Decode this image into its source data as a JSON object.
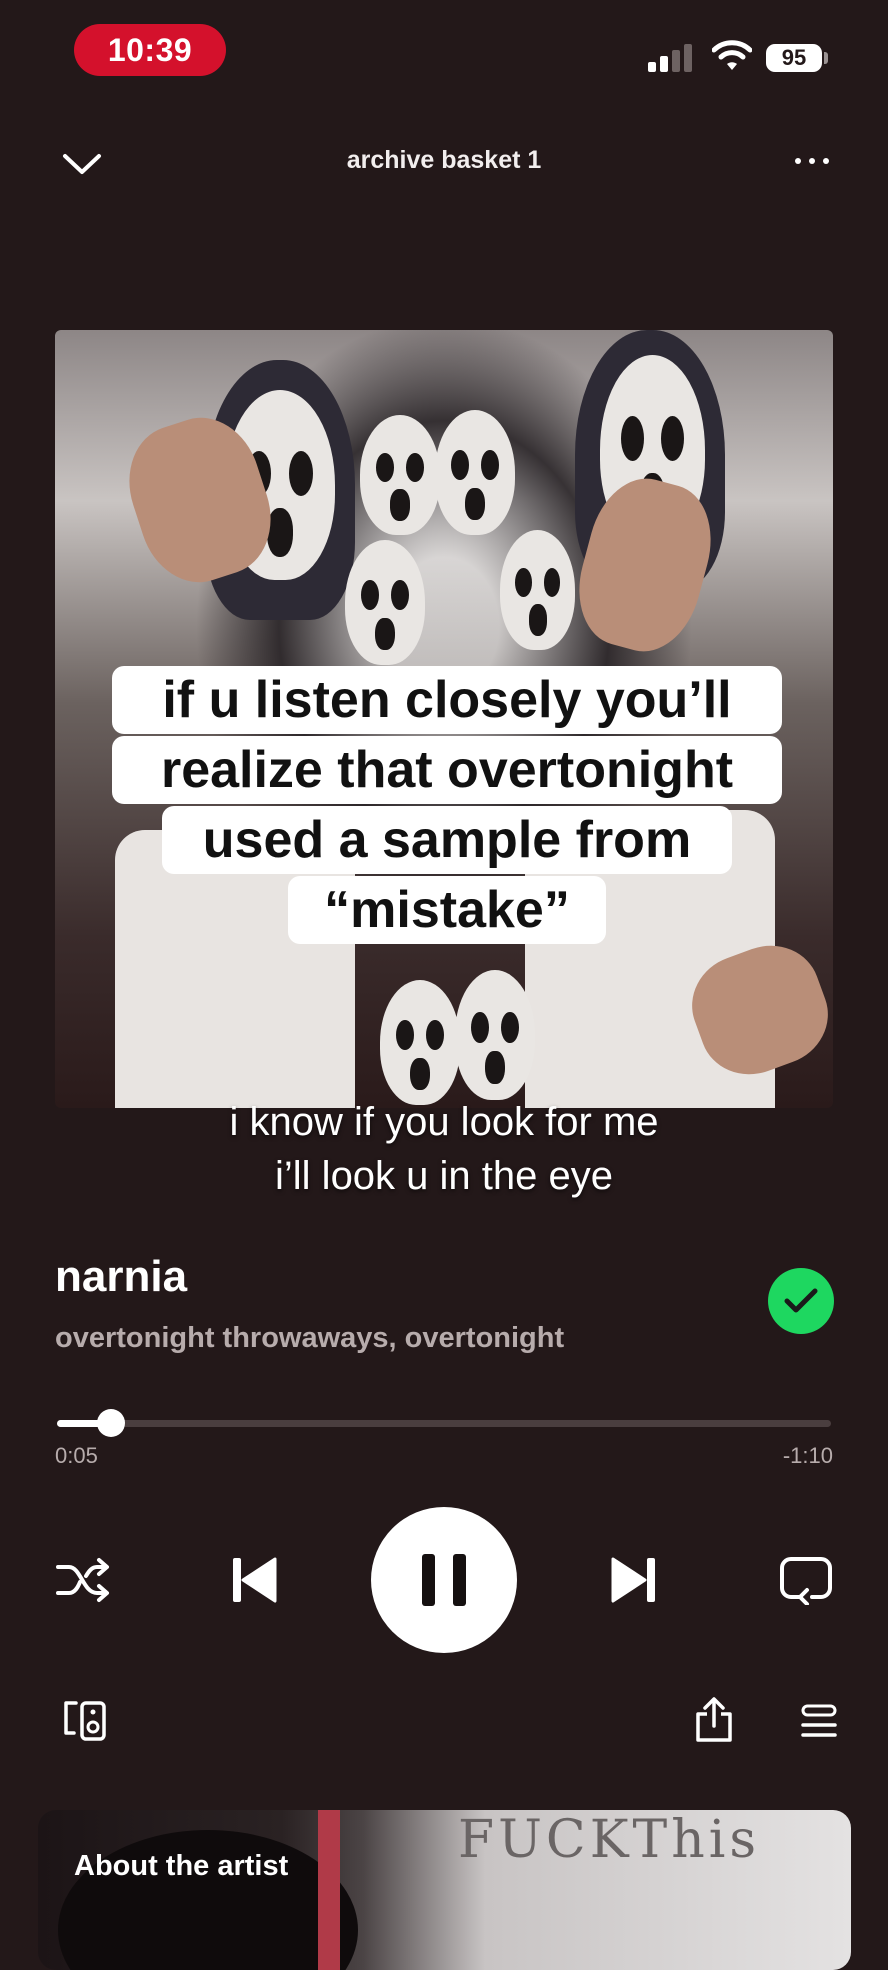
{
  "status_bar": {
    "time": "10:39",
    "battery": "95"
  },
  "header": {
    "title": "archive basket 1"
  },
  "artwork": {
    "caption_lines": [
      "if u listen closely you’ll",
      "realize that overtonight",
      "used a sample from",
      "“mistake”"
    ]
  },
  "lyrics": {
    "lines": [
      "i know if you look for me",
      "i’ll look u in the eye"
    ]
  },
  "track": {
    "title": "narnia",
    "artists": "overtonight throwaways, overtonight",
    "liked": true
  },
  "progress": {
    "elapsed": "0:05",
    "remaining": "-1:10",
    "fraction": 0.07
  },
  "controls": {
    "shuffle_icon": "shuffle-icon",
    "previous_icon": "previous-icon",
    "play_state": "playing",
    "next_icon": "next-icon",
    "repeat_icon": "repeat-icon"
  },
  "bottom": {
    "devices_icon": "connect-devices-icon",
    "share_icon": "share-icon",
    "queue_icon": "queue-icon"
  },
  "artist_card": {
    "label": "About the artist",
    "image_text": "FUCKThis"
  },
  "colors": {
    "background": "#231819",
    "time_pill": "#d4112c",
    "liked": "#1ed760"
  }
}
